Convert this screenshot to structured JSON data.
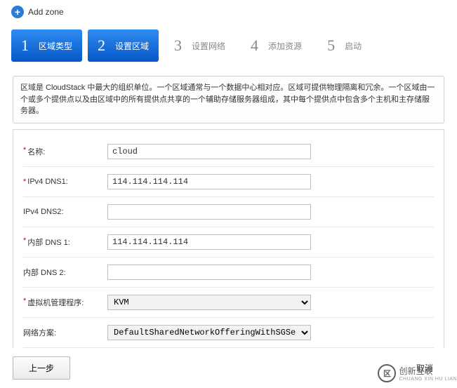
{
  "header": {
    "add_icon": "+",
    "title": "Add zone"
  },
  "steps": [
    {
      "num": "1",
      "label": "区域类型",
      "active": true
    },
    {
      "num": "2",
      "label": "设置区域",
      "active": true
    },
    {
      "num": "3",
      "label": "设置网络",
      "active": false
    },
    {
      "num": "4",
      "label": "添加资源",
      "active": false
    },
    {
      "num": "5",
      "label": "启动",
      "active": false
    }
  ],
  "description": "区域是 CloudStack 中最大的组织单位。一个区域通常与一个数据中心相对应。区域可提供物理隔离和冗余。一个区域由一个或多个提供点以及由区域中的所有提供点共享的一个辅助存储服务器组成，其中每个提供点中包含多个主机和主存储服务器。",
  "form": {
    "name_label": "名称:",
    "name_value": "cloud",
    "ipv4dns1_label": "IPv4 DNS1:",
    "ipv4dns1_value": "114.114.114.114",
    "ipv4dns2_label": "IPv4 DNS2:",
    "ipv4dns2_value": "",
    "intdns1_label": "内部 DNS 1:",
    "intdns1_value": "114.114.114.114",
    "intdns2_label": "内部 DNS 2:",
    "intdns2_value": "",
    "hypervisor_label": "虚拟机管理程序:",
    "hypervisor_value": "KVM",
    "network_label": "网络方案:",
    "network_value": "DefaultSharedNetworkOfferingWithSGService"
  },
  "footer": {
    "prev": "上一步",
    "cancel": "取消"
  },
  "watermark": {
    "logo": "区",
    "text": "创新互联",
    "sub": "CHUANG XIN HU LIAN"
  }
}
